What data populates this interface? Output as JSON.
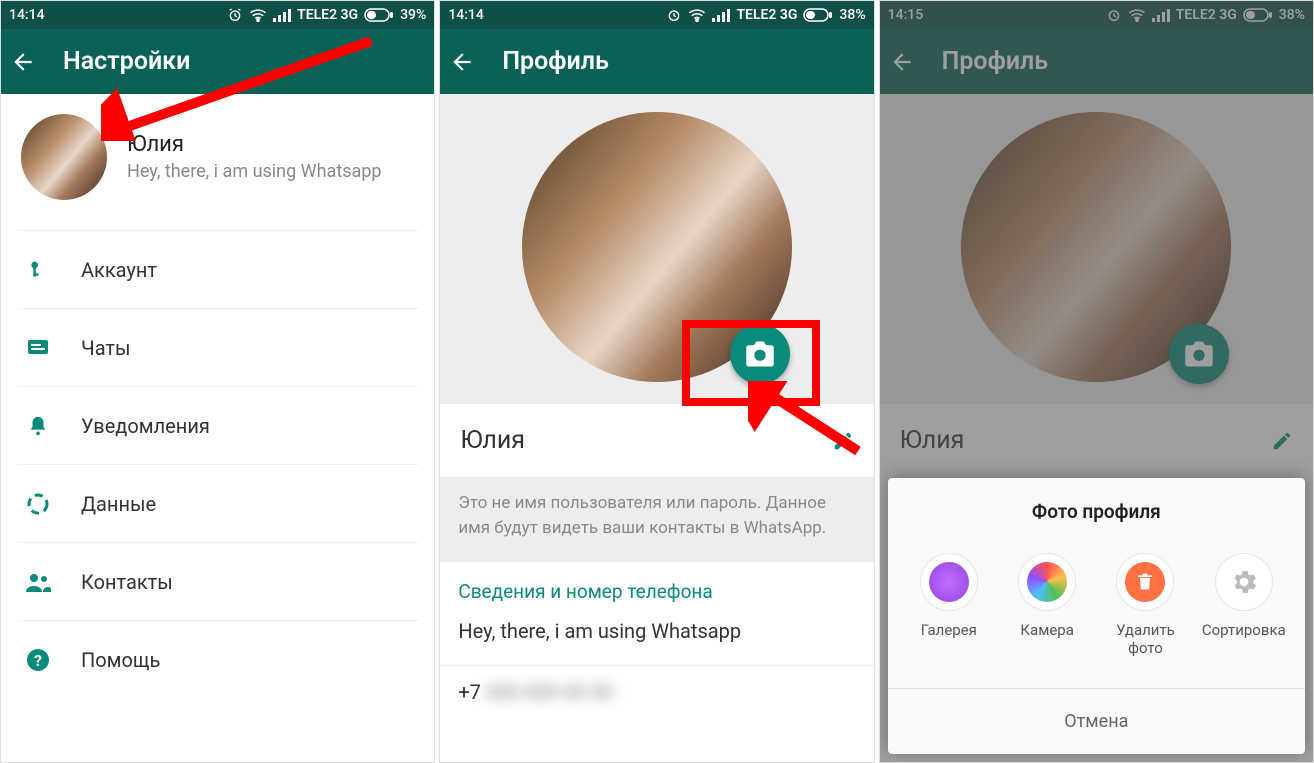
{
  "screen1": {
    "status": {
      "time": "14:14",
      "carrier": "TELE2 3G",
      "battery": "39%"
    },
    "header_title": "Настройки",
    "profile": {
      "name": "Юлия",
      "status": "Hey, there, i am using Whatsapp"
    },
    "menu": {
      "account": "Аккаунт",
      "chats": "Чаты",
      "notifications": "Уведомления",
      "data": "Данные",
      "contacts": "Контакты",
      "help": "Помощь"
    }
  },
  "screen2": {
    "status": {
      "time": "14:14",
      "carrier": "TELE2 3G",
      "battery": "38%"
    },
    "header_title": "Профиль",
    "name": "Юлия",
    "hint": "Это не имя пользователя или пароль. Данное имя будут видеть ваши контакты в WhatsApp.",
    "section_title": "Сведения и номер телефона",
    "status_text": "Hey, there, i am using Whatsapp",
    "phone_prefix": "+7"
  },
  "screen3": {
    "status": {
      "time": "14:15",
      "carrier": "TELE2 3G",
      "battery": "38%"
    },
    "header_title": "Профиль",
    "name": "Юлия",
    "sheet": {
      "title": "Фото профиля",
      "gallery": "Галерея",
      "camera": "Камера",
      "delete": "Удалить фото",
      "sort": "Сортировка",
      "cancel": "Отмена"
    }
  }
}
